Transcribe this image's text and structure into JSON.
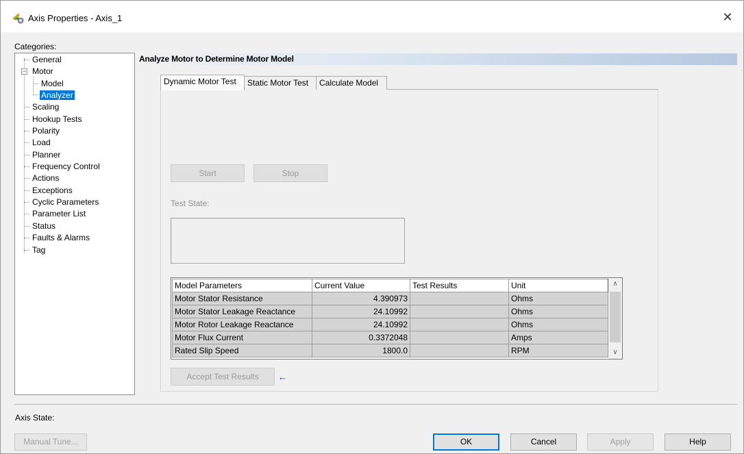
{
  "window": {
    "title": "Axis Properties - Axis_1",
    "close_glyph": "✕"
  },
  "categories": {
    "label": "Categories:",
    "items": [
      {
        "label": "General"
      },
      {
        "label": "Motor",
        "expander": "−"
      },
      {
        "label": "Model"
      },
      {
        "label": "Analyzer",
        "selected": true
      },
      {
        "label": "Scaling"
      },
      {
        "label": "Hookup Tests"
      },
      {
        "label": "Polarity"
      },
      {
        "label": "Load"
      },
      {
        "label": "Planner"
      },
      {
        "label": "Frequency Control"
      },
      {
        "label": "Actions"
      },
      {
        "label": "Exceptions"
      },
      {
        "label": "Cyclic Parameters"
      },
      {
        "label": "Parameter List"
      },
      {
        "label": "Status"
      },
      {
        "label": "Faults & Alarms"
      },
      {
        "label": "Tag"
      }
    ]
  },
  "panel": {
    "title": "Analyze Motor to Determine Motor Model"
  },
  "tabs": [
    {
      "label": "Dynamic Motor Test",
      "active": true
    },
    {
      "label": "Static Motor Test",
      "active": false
    },
    {
      "label": "Calculate Model",
      "active": false
    }
  ],
  "test": {
    "start_label": "Start",
    "stop_label": "Stop",
    "test_state_label": "Test State:",
    "accept_label": "Accept Test Results",
    "accept_indicator": "←"
  },
  "grid": {
    "columns": [
      "Model Parameters",
      "Current Value",
      "Test Results",
      "Unit"
    ],
    "rows": [
      [
        "Motor Stator Resistance",
        "4.390973",
        "",
        "Ohms"
      ],
      [
        "Motor Stator Leakage Reactance",
        "24.10992",
        "",
        "Ohms"
      ],
      [
        "Motor Rotor Leakage Reactance",
        "24.10992",
        "",
        "Ohms"
      ],
      [
        "Motor Flux Current",
        "0.3372048",
        "",
        "Amps"
      ],
      [
        "Rated Slip Speed",
        "1800.0",
        "",
        "RPM"
      ]
    ],
    "scroll_up_glyph": "∧",
    "scroll_down_glyph": "∨"
  },
  "footer": {
    "axis_state_label": "Axis State:",
    "manual_tune_label": "Manual Tune...",
    "ok_label": "OK",
    "cancel_label": "Cancel",
    "apply_label": "Apply",
    "help_label": "Help"
  },
  "colors": {
    "selection": "#0078d7",
    "header_gradient_end": "#b6c9e0",
    "accept_arrow": "#1040d0"
  },
  "icons": {
    "app": "axis-gear-icon",
    "close": "close-icon",
    "accept_indicator": "arrow-left-icon"
  }
}
